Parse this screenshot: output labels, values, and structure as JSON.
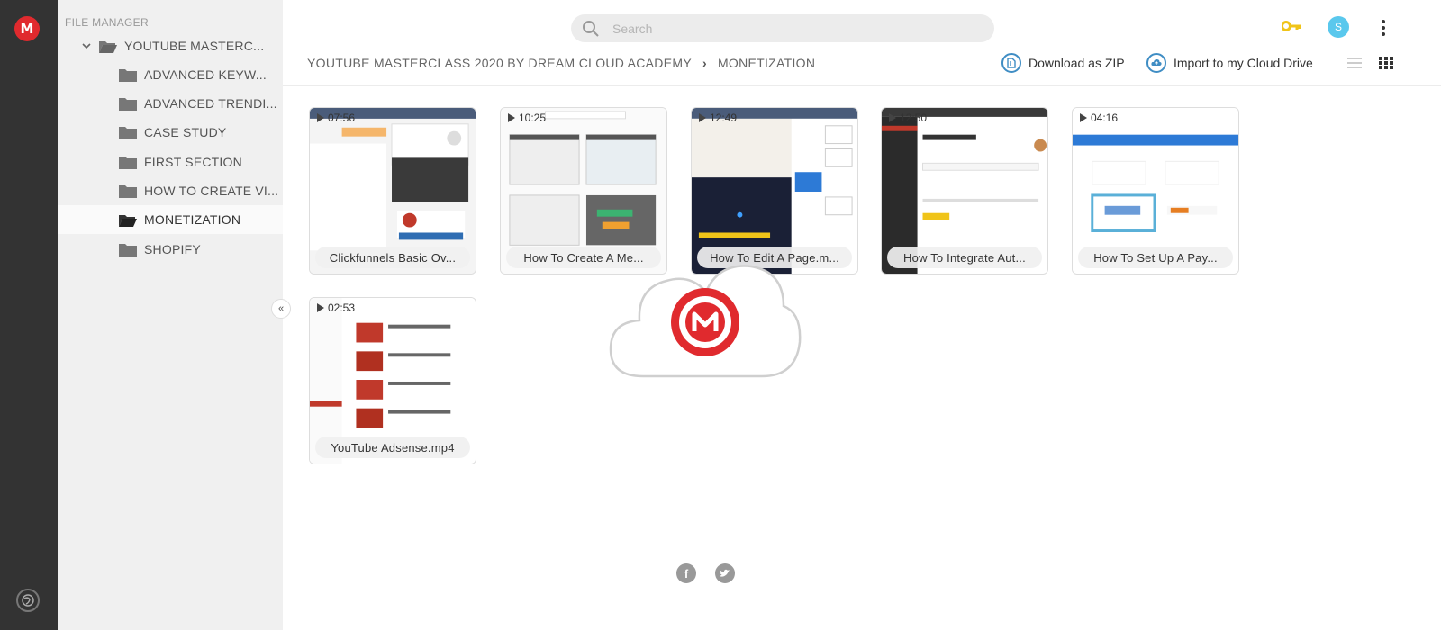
{
  "app": {
    "brand_letter": "M"
  },
  "sidebar": {
    "heading": "FILE MANAGER",
    "root": "YOUTUBE MASTERC...",
    "items": [
      {
        "label": "ADVANCED KEYW...",
        "selected": false
      },
      {
        "label": "ADVANCED TRENDI...",
        "selected": false
      },
      {
        "label": "CASE STUDY",
        "selected": false
      },
      {
        "label": "FIRST SECTION",
        "selected": false
      },
      {
        "label": "HOW TO CREATE VI...",
        "selected": false
      },
      {
        "label": "MONETIZATION",
        "selected": true
      },
      {
        "label": "SHOPIFY",
        "selected": false
      }
    ],
    "collapse_glyph": "«"
  },
  "search": {
    "placeholder": "Search",
    "value": ""
  },
  "header": {
    "avatar_letter": "S",
    "breadcrumb": [
      "YOUTUBE MASTERCLASS 2020 BY DREAM CLOUD ACADEMY",
      "MONETIZATION"
    ],
    "breadcrumb_sep": "›",
    "download_zip": "Download as ZIP",
    "import_drive": "Import to my Cloud Drive"
  },
  "files": [
    {
      "duration": "07:56",
      "name": "Clickfunnels Basic Ov...",
      "thumb": "light-dashboard"
    },
    {
      "duration": "10:25",
      "name": "How To Create A Me...",
      "thumb": "light-panels"
    },
    {
      "duration": "12:49",
      "name": "How To Edit A Page.m...",
      "thumb": "dark-editor"
    },
    {
      "duration": "12:50",
      "name": "How To Integrate Aut...",
      "thumb": "dark-sidebar-form"
    },
    {
      "duration": "04:16",
      "name": "How To Set Up A Pay...",
      "thumb": "blue-header-grid"
    },
    {
      "duration": "02:53",
      "name": "YouTube Adsense.mp4",
      "thumb": "video-list"
    }
  ],
  "colors": {
    "brand_red": "#e02a2e",
    "accent_blue": "#3f8dc4",
    "key_gold": "#f0c419",
    "avatar_blue": "#5ac8ed"
  },
  "footer": {
    "facebook": "f",
    "twitter_icon": "twitter-icon"
  }
}
